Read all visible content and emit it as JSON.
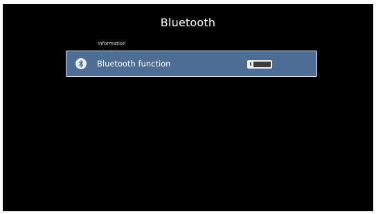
{
  "page": {
    "title": "Bluetooth"
  },
  "section": {
    "label": "Information"
  },
  "rows": [
    {
      "label": "Bluetooth function",
      "icon": "bluetooth-icon",
      "toggle": {
        "state": "off"
      }
    }
  ],
  "colors": {
    "background": "#000000",
    "row_selected": "#4e6d94",
    "row_border": "#d9e2ee",
    "text": "#ffffff"
  }
}
